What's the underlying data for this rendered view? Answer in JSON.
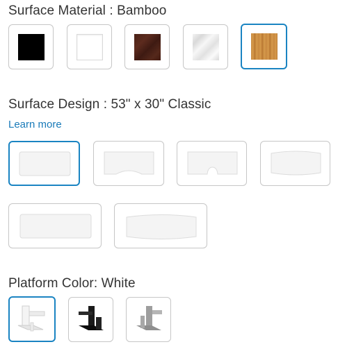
{
  "material": {
    "label": "Surface Material",
    "separator": " : ",
    "selected": "Bamboo",
    "options": [
      {
        "name": "Black",
        "color": "#000000"
      },
      {
        "name": "White",
        "color": "#ffffff"
      },
      {
        "name": "Walnut",
        "color": "#4f2418"
      },
      {
        "name": "Marble",
        "color": "#e6e6e6"
      },
      {
        "name": "Bamboo",
        "color": "#c98a3f"
      }
    ]
  },
  "design": {
    "label": "Surface Design",
    "separator": " : ",
    "selected": "53\" x 30\" Classic",
    "learn_more": "Learn more",
    "options": [
      "Classic",
      "Curved",
      "Notched",
      "Bowed",
      "Wide",
      "Wide Bowed"
    ]
  },
  "platform": {
    "label": "Platform Color",
    "separator": ": ",
    "selected": "White",
    "options": [
      {
        "name": "White",
        "color": "#f2f2f2"
      },
      {
        "name": "Black",
        "color": "#111111"
      },
      {
        "name": "Gray",
        "color": "#a9a9a9"
      }
    ]
  },
  "accent_color": "#1a84c2",
  "link_color": "#1a7bb9"
}
